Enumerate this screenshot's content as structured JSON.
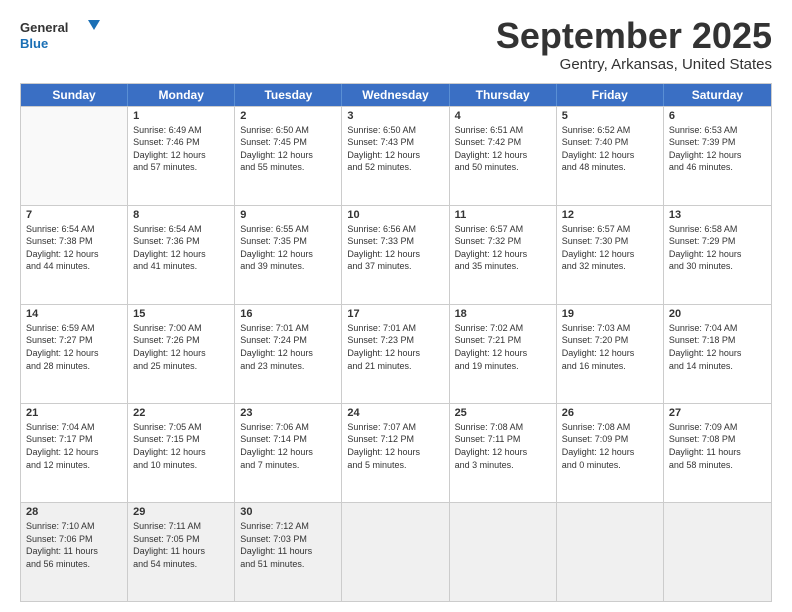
{
  "logo": {
    "line1": "General",
    "line2": "Blue"
  },
  "title": "September 2025",
  "subtitle": "Gentry, Arkansas, United States",
  "days_of_week": [
    "Sunday",
    "Monday",
    "Tuesday",
    "Wednesday",
    "Thursday",
    "Friday",
    "Saturday"
  ],
  "weeks": [
    [
      {
        "day": "",
        "info": ""
      },
      {
        "day": "1",
        "info": "Sunrise: 6:49 AM\nSunset: 7:46 PM\nDaylight: 12 hours\nand 57 minutes."
      },
      {
        "day": "2",
        "info": "Sunrise: 6:50 AM\nSunset: 7:45 PM\nDaylight: 12 hours\nand 55 minutes."
      },
      {
        "day": "3",
        "info": "Sunrise: 6:50 AM\nSunset: 7:43 PM\nDaylight: 12 hours\nand 52 minutes."
      },
      {
        "day": "4",
        "info": "Sunrise: 6:51 AM\nSunset: 7:42 PM\nDaylight: 12 hours\nand 50 minutes."
      },
      {
        "day": "5",
        "info": "Sunrise: 6:52 AM\nSunset: 7:40 PM\nDaylight: 12 hours\nand 48 minutes."
      },
      {
        "day": "6",
        "info": "Sunrise: 6:53 AM\nSunset: 7:39 PM\nDaylight: 12 hours\nand 46 minutes."
      }
    ],
    [
      {
        "day": "7",
        "info": "Sunrise: 6:54 AM\nSunset: 7:38 PM\nDaylight: 12 hours\nand 44 minutes."
      },
      {
        "day": "8",
        "info": "Sunrise: 6:54 AM\nSunset: 7:36 PM\nDaylight: 12 hours\nand 41 minutes."
      },
      {
        "day": "9",
        "info": "Sunrise: 6:55 AM\nSunset: 7:35 PM\nDaylight: 12 hours\nand 39 minutes."
      },
      {
        "day": "10",
        "info": "Sunrise: 6:56 AM\nSunset: 7:33 PM\nDaylight: 12 hours\nand 37 minutes."
      },
      {
        "day": "11",
        "info": "Sunrise: 6:57 AM\nSunset: 7:32 PM\nDaylight: 12 hours\nand 35 minutes."
      },
      {
        "day": "12",
        "info": "Sunrise: 6:57 AM\nSunset: 7:30 PM\nDaylight: 12 hours\nand 32 minutes."
      },
      {
        "day": "13",
        "info": "Sunrise: 6:58 AM\nSunset: 7:29 PM\nDaylight: 12 hours\nand 30 minutes."
      }
    ],
    [
      {
        "day": "14",
        "info": "Sunrise: 6:59 AM\nSunset: 7:27 PM\nDaylight: 12 hours\nand 28 minutes."
      },
      {
        "day": "15",
        "info": "Sunrise: 7:00 AM\nSunset: 7:26 PM\nDaylight: 12 hours\nand 25 minutes."
      },
      {
        "day": "16",
        "info": "Sunrise: 7:01 AM\nSunset: 7:24 PM\nDaylight: 12 hours\nand 23 minutes."
      },
      {
        "day": "17",
        "info": "Sunrise: 7:01 AM\nSunset: 7:23 PM\nDaylight: 12 hours\nand 21 minutes."
      },
      {
        "day": "18",
        "info": "Sunrise: 7:02 AM\nSunset: 7:21 PM\nDaylight: 12 hours\nand 19 minutes."
      },
      {
        "day": "19",
        "info": "Sunrise: 7:03 AM\nSunset: 7:20 PM\nDaylight: 12 hours\nand 16 minutes."
      },
      {
        "day": "20",
        "info": "Sunrise: 7:04 AM\nSunset: 7:18 PM\nDaylight: 12 hours\nand 14 minutes."
      }
    ],
    [
      {
        "day": "21",
        "info": "Sunrise: 7:04 AM\nSunset: 7:17 PM\nDaylight: 12 hours\nand 12 minutes."
      },
      {
        "day": "22",
        "info": "Sunrise: 7:05 AM\nSunset: 7:15 PM\nDaylight: 12 hours\nand 10 minutes."
      },
      {
        "day": "23",
        "info": "Sunrise: 7:06 AM\nSunset: 7:14 PM\nDaylight: 12 hours\nand 7 minutes."
      },
      {
        "day": "24",
        "info": "Sunrise: 7:07 AM\nSunset: 7:12 PM\nDaylight: 12 hours\nand 5 minutes."
      },
      {
        "day": "25",
        "info": "Sunrise: 7:08 AM\nSunset: 7:11 PM\nDaylight: 12 hours\nand 3 minutes."
      },
      {
        "day": "26",
        "info": "Sunrise: 7:08 AM\nSunset: 7:09 PM\nDaylight: 12 hours\nand 0 minutes."
      },
      {
        "day": "27",
        "info": "Sunrise: 7:09 AM\nSunset: 7:08 PM\nDaylight: 11 hours\nand 58 minutes."
      }
    ],
    [
      {
        "day": "28",
        "info": "Sunrise: 7:10 AM\nSunset: 7:06 PM\nDaylight: 11 hours\nand 56 minutes."
      },
      {
        "day": "29",
        "info": "Sunrise: 7:11 AM\nSunset: 7:05 PM\nDaylight: 11 hours\nand 54 minutes."
      },
      {
        "day": "30",
        "info": "Sunrise: 7:12 AM\nSunset: 7:03 PM\nDaylight: 11 hours\nand 51 minutes."
      },
      {
        "day": "",
        "info": ""
      },
      {
        "day": "",
        "info": ""
      },
      {
        "day": "",
        "info": ""
      },
      {
        "day": "",
        "info": ""
      }
    ]
  ]
}
